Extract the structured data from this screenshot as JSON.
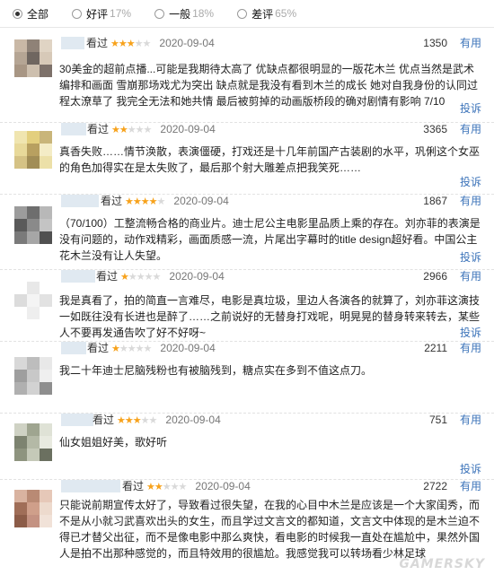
{
  "filters": [
    {
      "label": "全部",
      "pct": "",
      "selected": true
    },
    {
      "label": "好评",
      "pct": "17%",
      "selected": false
    },
    {
      "label": "一般",
      "pct": "18%",
      "selected": false
    },
    {
      "label": "差评",
      "pct": "65%",
      "selected": false
    }
  ],
  "reviews": [
    {
      "looked": "看过",
      "stars": 3,
      "date": "2020-09-04",
      "votes": "1350",
      "useful": "有用",
      "content": "30美金的超前点播...可能是我期待太高了 优缺点都很明显的一版花木兰 优点当然是武术编排和画面 雪崩那场戏尤为突出 缺点就是我没有看到木兰的成长 她对自我身份的认同过程太潦草了 我完全无法和她共情 最后被剪掉的动画版桥段的确对剧情有影响 7/10",
      "report": "投诉",
      "avatar": [
        "#c9b8a6",
        "#8f8277",
        "#e0d4c4",
        "#b5a594",
        "#6f6660",
        "#d7c9b8",
        "#a89684",
        "#cdbfae",
        "#7d716a"
      ]
    },
    {
      "looked": "看过",
      "stars": 2,
      "date": "2020-09-04",
      "votes": "3365",
      "useful": "有用",
      "content": "真香失败……情节涣散，表演僵硬，打戏还是十几年前国产古装剧的水平，巩俐这个女巫的角色加得实在是太失败了，最后那个射大雕差点把我笑死……",
      "report": "投诉",
      "avatar": [
        "#f0e5b0",
        "#e3cf7e",
        "#c9b57a",
        "#e8d99a",
        "#b8a060",
        "#f4ecc6",
        "#d5c285",
        "#a18d56",
        "#ece0a8"
      ]
    },
    {
      "looked": "看过",
      "stars": 4,
      "date": "2020-09-04",
      "votes": "1867",
      "useful": "有用",
      "content": "（70/100）工整流畅合格的商业片。迪士尼公主电影里品质上乘的存在。刘亦菲的表演是没有问题的，动作戏精彩，画面质感一流，片尾出字幕时的title design超好看。中国公主花木兰没有让人失望。",
      "report": "投诉",
      "avatar": [
        "#9c9c9c",
        "#6e6e6e",
        "#b8b8b8",
        "#5a5a5a",
        "#8a8a8a",
        "#c4c4c4",
        "#7a7a7a",
        "#a6a6a6",
        "#505050"
      ]
    },
    {
      "looked": "看过",
      "stars": 1,
      "date": "2020-09-04",
      "votes": "2966",
      "useful": "有用",
      "content": "我是真看了，拍的简直一言难尽，电影是真垃圾，里边人各演各的就算了，刘亦菲这演技一如既往没有长进也是醉了……之前说好的无替身打戏呢，明晃晃的替身转来转去，某些人不要再发通告吹了好不好呀~",
      "report": "投诉",
      "avatar": [
        "#ffffff",
        "#e8e8e8",
        "#ffffff",
        "#dcdcdc",
        "#f4f4f4",
        "#e2e2e2",
        "#ffffff",
        "#eeeeee",
        "#ffffff"
      ]
    },
    {
      "looked": "看过",
      "stars": 1,
      "date": "2020-09-04",
      "votes": "2211",
      "useful": "有用",
      "content": "我二十年迪士尼脑残粉也有被脑残到，糖点实在多到不值这点刀。",
      "report": "",
      "avatar": [
        "#d8d8d8",
        "#bdbdbd",
        "#e8e8e8",
        "#9e9e9e",
        "#c8c8c8",
        "#efefef",
        "#b0b0b0",
        "#d2d2d2",
        "#8e8e8e"
      ]
    },
    {
      "looked": "看过",
      "stars": 3,
      "date": "2020-09-04",
      "votes": "751",
      "useful": "有用",
      "content": "仙女姐姐好美，歌好听",
      "report": "投诉",
      "avatar": [
        "#cfd2c4",
        "#9fa590",
        "#dfe2d6",
        "#7d8370",
        "#b4b9a6",
        "#e8eae0",
        "#8e947f",
        "#c5c9b8",
        "#6b7060"
      ]
    },
    {
      "looked": "看过",
      "stars": 2,
      "date": "2020-09-04",
      "votes": "2722",
      "useful": "有用",
      "content": "只能说前期宣传太好了，导致看过很失望，在我的心目中木兰是应该是一个大家闺秀，而不是从小就习武喜欢出头的女生，而且学过文言文的都知道，文言文中体现的是木兰迫不得已才替父出征，而不是像电影中那么爽快，看电影的时候我一直处在尴尬中，果然外国人是拍不出那种感觉的，而且特效用的很尴尬。我感觉我可以转场看少林足球",
      "report": "",
      "avatar": [
        "#d9b3a0",
        "#b98a74",
        "#e6c8b8",
        "#a06e58",
        "#cf9f8a",
        "#eddacd",
        "#8c5c48",
        "#c49282",
        "#f1e2d8"
      ]
    }
  ],
  "watermark": "GAMERSKY"
}
